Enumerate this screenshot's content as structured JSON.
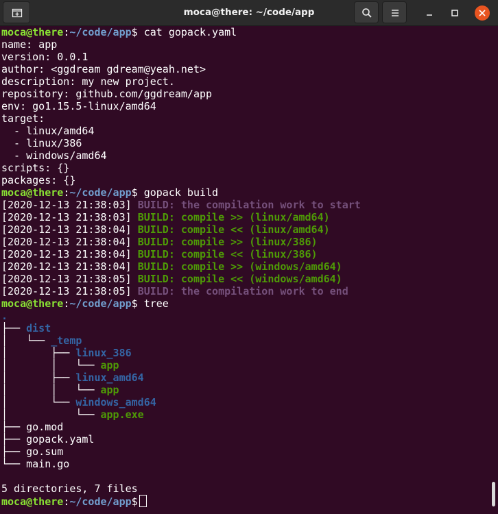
{
  "window": {
    "title": "moca@there: ~/code/app"
  },
  "icons": {
    "new_tab": "new-tab-icon",
    "search": "search-icon",
    "menu": "hamburger-menu-icon",
    "minimize": "minimize-icon",
    "maximize": "maximize-icon",
    "close": "close-icon"
  },
  "colors": {
    "terminal_bg": "#300a24",
    "prompt_user": "#8ae234",
    "prompt_path": "#729fcf",
    "build_dim": "#75507b",
    "build_green": "#4e9a06",
    "tree_dir": "#3465a4",
    "close_button": "#e95420"
  },
  "prompt": {
    "user_host": "moca@there",
    "colon": ":",
    "path": "~/code/app",
    "symbol": "$"
  },
  "commands": {
    "cat": " cat gopack.yaml",
    "build": " gopack build",
    "tree": " tree",
    "current": " "
  },
  "yaml_lines": [
    "name: app",
    "version: 0.0.1",
    "author: <ggdream gdream@yeah.net>",
    "description: my new project.",
    "repository: github.com/ggdream/app",
    "env: go1.15.5-linux/amd64",
    "target:",
    "  - linux/amd64",
    "  - linux/386",
    "  - windows/amd64",
    "scripts: {}",
    "packages: {}"
  ],
  "build_log": [
    {
      "ts": "[2020-12-13 21:38:03] ",
      "msg": "BUILD: the compilation work to start",
      "style": "dim"
    },
    {
      "ts": "[2020-12-13 21:38:03] ",
      "msg": "BUILD: compile >> (linux/amd64)",
      "style": "green"
    },
    {
      "ts": "[2020-12-13 21:38:04] ",
      "msg": "BUILD: compile << (linux/amd64)",
      "style": "green"
    },
    {
      "ts": "[2020-12-13 21:38:04] ",
      "msg": "BUILD: compile >> (linux/386)",
      "style": "green"
    },
    {
      "ts": "[2020-12-13 21:38:04] ",
      "msg": "BUILD: compile << (linux/386)",
      "style": "green"
    },
    {
      "ts": "[2020-12-13 21:38:04] ",
      "msg": "BUILD: compile >> (windows/amd64)",
      "style": "green"
    },
    {
      "ts": "[2020-12-13 21:38:05] ",
      "msg": "BUILD: compile << (windows/amd64)",
      "style": "green"
    },
    {
      "ts": "[2020-12-13 21:38:05] ",
      "msg": "BUILD: the compilation work to end",
      "style": "dim"
    }
  ],
  "tree": {
    "root": ".",
    "entries": [
      {
        "prefix": "├── ",
        "name": "dist",
        "kind": "dir"
      },
      {
        "prefix": "│   └── ",
        "name": "_temp",
        "kind": "dir"
      },
      {
        "prefix": "│       ├── ",
        "name": "linux_386",
        "kind": "dir"
      },
      {
        "prefix": "│       │   └── ",
        "name": "app",
        "kind": "exe"
      },
      {
        "prefix": "│       ├── ",
        "name": "linux_amd64",
        "kind": "dir"
      },
      {
        "prefix": "│       │   └── ",
        "name": "app",
        "kind": "exe"
      },
      {
        "prefix": "│       └── ",
        "name": "windows_amd64",
        "kind": "dir"
      },
      {
        "prefix": "│           └── ",
        "name": "app.exe",
        "kind": "exe"
      },
      {
        "prefix": "├── ",
        "name": "go.mod",
        "kind": "file"
      },
      {
        "prefix": "├── ",
        "name": "gopack.yaml",
        "kind": "file"
      },
      {
        "prefix": "├── ",
        "name": "go.sum",
        "kind": "file"
      },
      {
        "prefix": "└── ",
        "name": "main.go",
        "kind": "file"
      }
    ],
    "summary": "5 directories, 7 files"
  }
}
